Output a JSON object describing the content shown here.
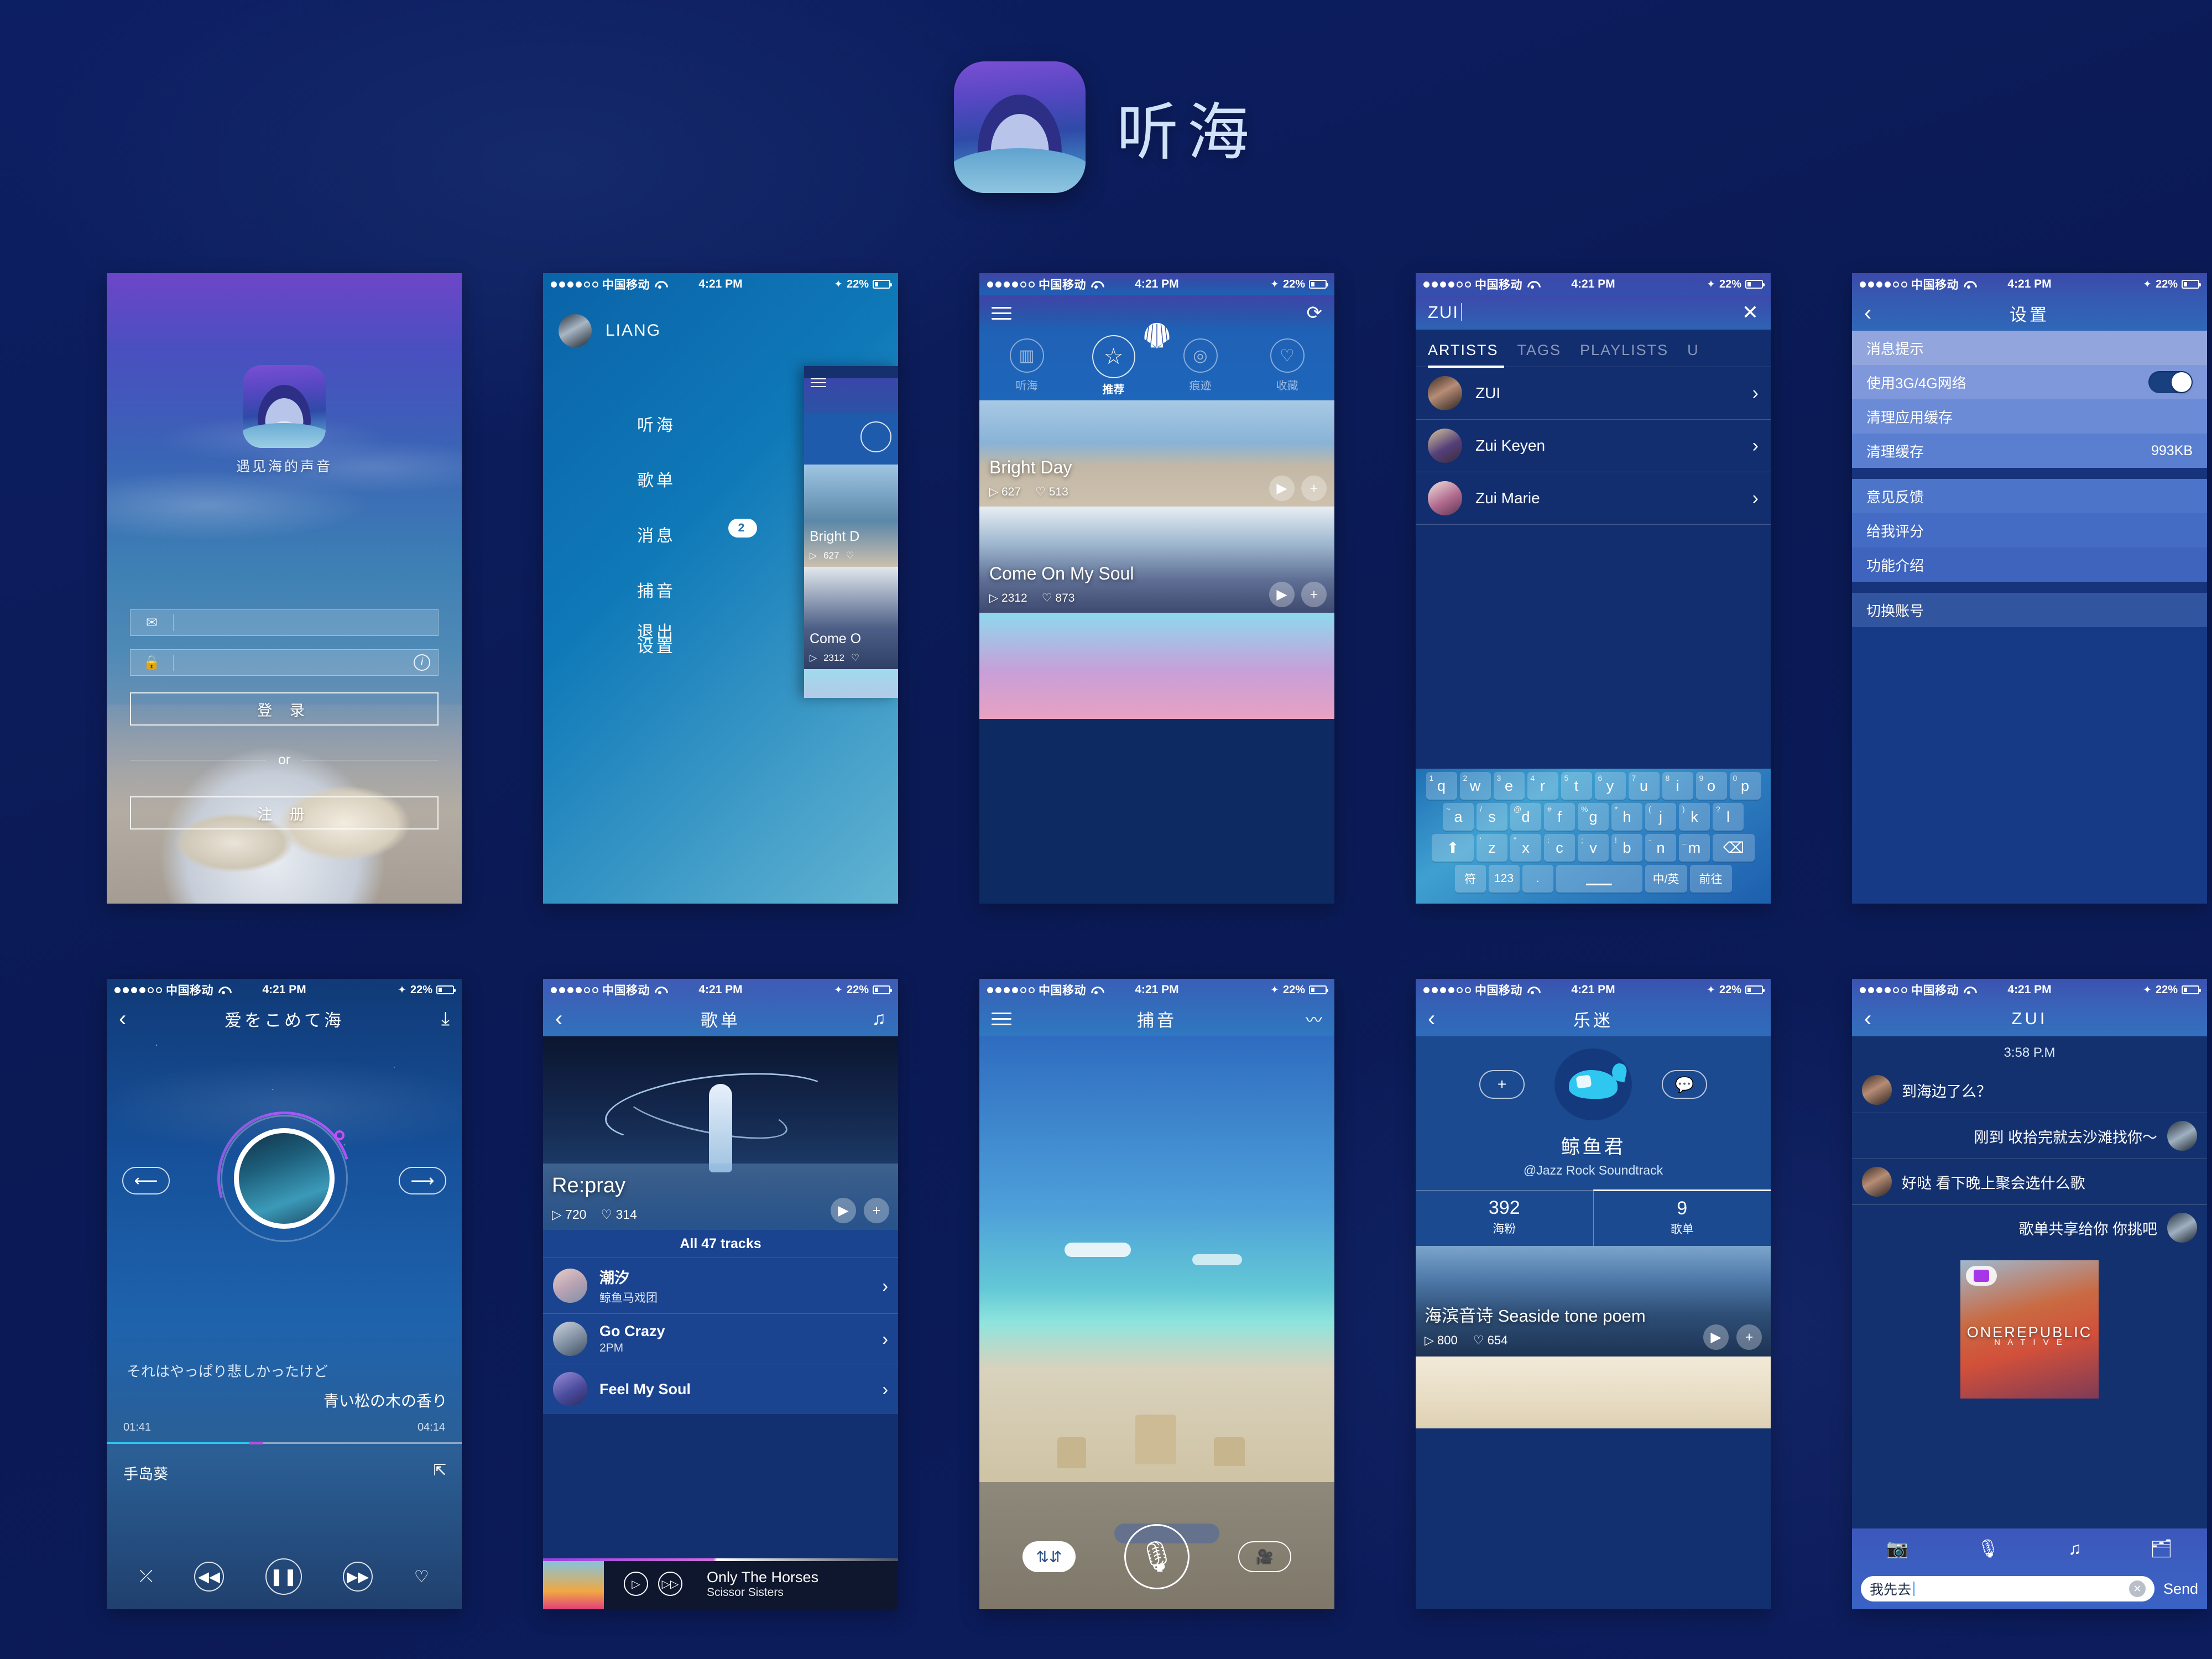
{
  "header": {
    "app_title": "听海",
    "icon_name": "app-icon-shell"
  },
  "status_bar": {
    "carrier": "中国移动",
    "time": "4:21 PM",
    "battery": "22%"
  },
  "screens": {
    "login": {
      "tagline": "遇见海的声音",
      "email_placeholder": "",
      "password_placeholder": "",
      "login_button": "登 录",
      "register_button": "注 册",
      "or_text": "or"
    },
    "drawer": {
      "user_name": "LIANG",
      "items": [
        {
          "label": "听海",
          "badge": ""
        },
        {
          "label": "歌单",
          "badge": ""
        },
        {
          "label": "消息",
          "badge": "2"
        },
        {
          "label": "捕音",
          "badge": ""
        },
        {
          "label": "设置",
          "badge": ""
        }
      ],
      "exit": "退出",
      "peek_cards": [
        {
          "title": "Bright D",
          "plays": "627"
        },
        {
          "title": "Come O",
          "plays": "2312"
        }
      ]
    },
    "feed": {
      "tabs": [
        {
          "label": "听海",
          "icon": "grid-icon",
          "active": false
        },
        {
          "label": "推荐",
          "icon": "star-icon",
          "active": true
        },
        {
          "label": "痕迹",
          "icon": "vinyl-icon",
          "active": false
        },
        {
          "label": "收藏",
          "icon": "heart-icon",
          "active": false
        }
      ],
      "cards": [
        {
          "title": "Bright Day",
          "plays": "627",
          "likes": "513"
        },
        {
          "title": "Come On My Soul",
          "plays": "2312",
          "likes": "873"
        }
      ]
    },
    "search": {
      "query": "ZUI",
      "tabs": [
        "ARTISTS",
        "TAGS",
        "PLAYLISTS",
        "U"
      ],
      "active_tab": "ARTISTS",
      "results": [
        "ZUI",
        "Zui Keyen",
        "Zui Marie"
      ],
      "keyboard": {
        "row1": [
          {
            "k": "q",
            "n": "1"
          },
          {
            "k": "w",
            "n": "2"
          },
          {
            "k": "e",
            "n": "3"
          },
          {
            "k": "r",
            "n": "4"
          },
          {
            "k": "t",
            "n": "5"
          },
          {
            "k": "y",
            "n": "6"
          },
          {
            "k": "u",
            "n": "7"
          },
          {
            "k": "i",
            "n": "8"
          },
          {
            "k": "o",
            "n": "9"
          },
          {
            "k": "p",
            "n": "0"
          }
        ],
        "row2": [
          {
            "k": "a",
            "n": "~"
          },
          {
            "k": "s",
            "n": "/"
          },
          {
            "k": "d",
            "n": "@"
          },
          {
            "k": "f",
            "n": "#"
          },
          {
            "k": "g",
            "n": "%"
          },
          {
            "k": "h",
            "n": "*"
          },
          {
            "k": "j",
            "n": "("
          },
          {
            "k": "k",
            "n": ")"
          },
          {
            "k": "l",
            "n": "?"
          }
        ],
        "row3": [
          {
            "k": "z",
            "n": "'"
          },
          {
            "k": "x",
            "n": "\""
          },
          {
            "k": "c",
            "n": ":"
          },
          {
            "k": "v",
            "n": ";"
          },
          {
            "k": "b",
            "n": "!"
          },
          {
            "k": "n",
            "n": "-"
          },
          {
            "k": "m",
            "n": "_"
          }
        ],
        "shift": "⬆",
        "backspace": "⌫",
        "sym": "符",
        "num": "123",
        "period": ".",
        "space": "",
        "lang": "中/英",
        "go": "前往"
      }
    },
    "settings": {
      "title": "设置",
      "group1": [
        {
          "label": "消息提示",
          "value": "",
          "toggle": false
        },
        {
          "label": "使用3G/4G网络",
          "value": "",
          "toggle": true
        },
        {
          "label": "清理应用缓存",
          "value": "",
          "toggle": false
        },
        {
          "label": "清理缓存",
          "value": "993KB",
          "toggle": false
        }
      ],
      "group2": [
        {
          "label": "意见反馈"
        },
        {
          "label": "给我评分"
        },
        {
          "label": "功能介绍"
        }
      ],
      "group3": [
        {
          "label": "切换账号"
        }
      ]
    },
    "player": {
      "title": "爱をこめて海",
      "lyric1": "それはやっぱり悲しかったけど",
      "lyric2": "青い松の木の香り",
      "time_current": "01:41",
      "time_total": "04:14",
      "artist": "手岛葵"
    },
    "playlist": {
      "title": "歌单",
      "cover_title": "Re:pray",
      "plays": "720",
      "likes": "314",
      "all_tracks": "All  47 tracks",
      "tracks": [
        {
          "name": "潮汐",
          "artist": "鲸鱼马戏团"
        },
        {
          "name": "Go Crazy",
          "artist": "2PM"
        },
        {
          "name": "Feel My Soul",
          "artist": ""
        }
      ],
      "mini_player": {
        "title": "Only The Horses",
        "artist": "Scissor Sisters"
      }
    },
    "record": {
      "title": "捕音"
    },
    "profile": {
      "title": "乐迷",
      "name": "鲸鱼君",
      "tags": "@Jazz  Rock   Soundtrack",
      "stats": [
        {
          "value": "392",
          "label": "海粉",
          "active": false
        },
        {
          "value": "9",
          "label": "歌单",
          "active": true
        }
      ],
      "card": {
        "title": "海滨音诗 Seaside tone poem",
        "plays": "800",
        "likes": "654"
      }
    },
    "chat": {
      "title": "ZUI",
      "timestamp": "3:58 P.M",
      "messages": [
        {
          "text": "到海边了么？",
          "me": false
        },
        {
          "text": "刚到 收拾完就去沙滩找你～",
          "me": true
        },
        {
          "text": "好哒  看下晚上聚会选什么歌",
          "me": false
        },
        {
          "text": "歌单共享给你  你挑吧",
          "me": true
        }
      ],
      "album": {
        "name": "ONEREPUBLIC",
        "sub": "N A T I V E"
      },
      "input_value": "我先去",
      "send_label": "Send"
    }
  }
}
